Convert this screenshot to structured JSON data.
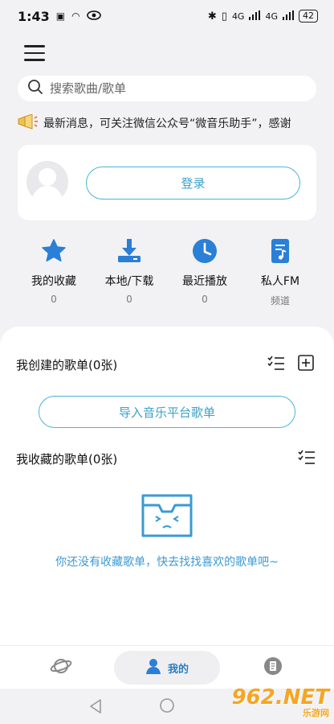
{
  "status_bar": {
    "time": "1:43",
    "network": "4G",
    "battery": "42"
  },
  "search": {
    "placeholder": "搜索歌曲/歌单"
  },
  "notice": {
    "text": "最新消息，可关注微信公众号“微音乐助手”，感谢"
  },
  "profile": {
    "login_label": "登录"
  },
  "quick_actions": [
    {
      "label": "我的收藏",
      "sub": "0",
      "icon": "star-icon"
    },
    {
      "label": "本地/下载",
      "sub": "0",
      "icon": "download-icon"
    },
    {
      "label": "最近播放",
      "sub": "0",
      "icon": "clock-icon"
    },
    {
      "label": "私人FM",
      "sub": "频道",
      "icon": "music-note-icon"
    }
  ],
  "created_playlists": {
    "title": "我创建的歌单(0张)",
    "import_label": "导入音乐平台歌单"
  },
  "favorite_playlists": {
    "title": "我收藏的歌单(0张)",
    "empty_text": "你还没有收藏歌单，快去找找喜欢的歌单吧~"
  },
  "bottom_nav": {
    "mine_label": "我的"
  },
  "watermark": {
    "brand": "962.NET",
    "caption": "乐游网"
  },
  "colors": {
    "accent": "#3aa2c8",
    "icon_blue": "#2a7fd6",
    "empty_text": "#3a9ad3"
  }
}
